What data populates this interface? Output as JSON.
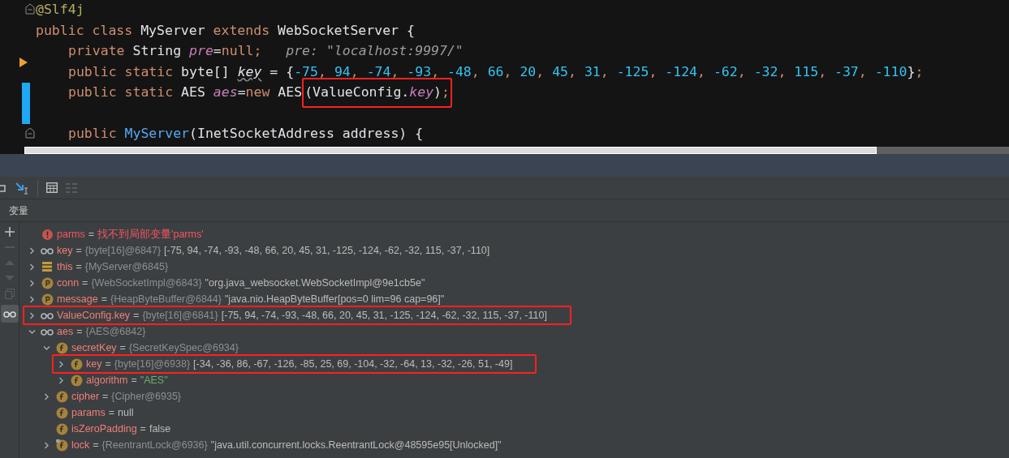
{
  "editor": {
    "lines": [
      {
        "kind": "fold",
        "indented": false,
        "tokens": [
          {
            "kind": "annot",
            "t": "@Slf4j"
          }
        ]
      },
      {
        "kind": "plain",
        "indented": false,
        "tokens": [
          {
            "kind": "kw",
            "t": "public class "
          },
          {
            "kind": "plain",
            "t": "MyServer "
          },
          {
            "kind": "kw",
            "t": "extends "
          },
          {
            "kind": "plain",
            "t": "WebSocketServer {"
          }
        ]
      },
      {
        "kind": "plain",
        "indented": true,
        "tokens": [
          {
            "kind": "kw",
            "t": "private "
          },
          {
            "kind": "plain",
            "t": "String "
          },
          {
            "kind": "field",
            "t": "pre"
          },
          {
            "kind": "plain",
            "t": "="
          },
          {
            "kind": "kw",
            "t": "null;"
          },
          {
            "kind": "hint",
            "t": "   pre: \"localhost:9997/\""
          }
        ]
      },
      {
        "kind": "arrow",
        "indented": true,
        "tokens": [
          {
            "kind": "kw",
            "t": "public static "
          },
          {
            "kind": "plain",
            "t": "byte[] "
          },
          {
            "kind": "squiggle",
            "t": "key"
          },
          {
            "kind": "plain",
            "t": " = {"
          },
          {
            "kind": "num",
            "t": "-75"
          },
          {
            "kind": "punct",
            "t": ", "
          },
          {
            "kind": "num",
            "t": "94"
          },
          {
            "kind": "punct",
            "t": ", "
          },
          {
            "kind": "num",
            "t": "-74"
          },
          {
            "kind": "punct",
            "t": ", "
          },
          {
            "kind": "num",
            "t": "-93"
          },
          {
            "kind": "punct",
            "t": ", "
          },
          {
            "kind": "num",
            "t": "-48"
          },
          {
            "kind": "punct",
            "t": ", "
          },
          {
            "kind": "num",
            "t": "66"
          },
          {
            "kind": "punct",
            "t": ", "
          },
          {
            "kind": "num",
            "t": "20"
          },
          {
            "kind": "punct",
            "t": ", "
          },
          {
            "kind": "num",
            "t": "45"
          },
          {
            "kind": "punct",
            "t": ", "
          },
          {
            "kind": "num",
            "t": "31"
          },
          {
            "kind": "punct",
            "t": ", "
          },
          {
            "kind": "num",
            "t": "-125"
          },
          {
            "kind": "punct",
            "t": ", "
          },
          {
            "kind": "num",
            "t": "-124"
          },
          {
            "kind": "punct",
            "t": ", "
          },
          {
            "kind": "num",
            "t": "-62"
          },
          {
            "kind": "punct",
            "t": ", "
          },
          {
            "kind": "num",
            "t": "-32"
          },
          {
            "kind": "punct",
            "t": ", "
          },
          {
            "kind": "num",
            "t": "115"
          },
          {
            "kind": "punct",
            "t": ", "
          },
          {
            "kind": "num",
            "t": "-37"
          },
          {
            "kind": "punct",
            "t": ", "
          },
          {
            "kind": "num",
            "t": "-110"
          },
          {
            "kind": "plain",
            "t": "}"
          },
          {
            "kind": "punct",
            "t": ";"
          }
        ]
      },
      {
        "kind": "changed",
        "indented": true,
        "tokens": [
          {
            "kind": "kw",
            "t": "public static "
          },
          {
            "kind": "plain",
            "t": "AES "
          },
          {
            "kind": "field",
            "t": "aes"
          },
          {
            "kind": "plain",
            "t": "="
          },
          {
            "kind": "kw",
            "t": "new "
          },
          {
            "kind": "plain",
            "t": "AES"
          }
        ],
        "boxed": [
          {
            "kind": "plain",
            "t": "(ValueConfig."
          },
          {
            "kind": "field",
            "t": "key"
          },
          {
            "kind": "plain",
            "t": ")"
          },
          {
            "kind": "punct",
            "t": ";"
          }
        ]
      },
      {
        "kind": "changed"
      },
      {
        "kind": "fold",
        "indented": true,
        "tokens": [
          {
            "kind": "kw",
            "t": "public "
          },
          {
            "kind": "method",
            "t": "MyServer"
          },
          {
            "kind": "plain",
            "t": "(InetSocketAddress address) {"
          }
        ]
      }
    ]
  },
  "variables_tab": "变量",
  "variables": [
    {
      "kind": "error",
      "name": "parms",
      "operator": "=",
      "value": {
        "kind": "error",
        "t": "找不到局部变量'parms'"
      }
    },
    {
      "kind": "watch",
      "name": "key",
      "operator": "=",
      "type": "{byte[16]@6847}",
      "value": {
        "kind": "plain",
        "t": "[-75, 94, -74, -93, -48, 66, 20, 45, 31, -125, -124, -62, -32, 115, -37, -110]"
      },
      "expanded": false
    },
    {
      "kind": "stack",
      "name": "this",
      "operator": "=",
      "type": "{MyServer@6845}",
      "expanded": false
    },
    {
      "kind": "p",
      "name": "conn",
      "operator": "=",
      "type": "{WebSocketImpl@6843}",
      "value": {
        "kind": "plain",
        "t": "\"org.java_websocket.WebSocketImpl@9e1cb5e\""
      },
      "expanded": false
    },
    {
      "kind": "p",
      "name": "message",
      "operator": "=",
      "type": "{HeapByteBuffer@6844}",
      "value": {
        "kind": "plain",
        "t": "\"java.nio.HeapByteBuffer[pos=0 lim=96 cap=96]\""
      },
      "expanded": false
    },
    {
      "kind": "watch",
      "name": "ValueConfig.key",
      "operator": "=",
      "type": "{byte[16]@6841}",
      "value": {
        "kind": "plain",
        "t": "[-75, 94, -74, -93, -48, 66, 20, 45, 31, -125, -124, -62, -32, 115, -37, -110]"
      },
      "expanded": false,
      "boxed": true
    },
    {
      "kind": "watch",
      "name": "aes",
      "operator": "=",
      "type": "{AES@6842}",
      "expanded": true,
      "children": [
        {
          "kind": "f",
          "name": "secretKey",
          "operator": "=",
          "type": "{SecretKeySpec@6934}",
          "expanded": true,
          "children": [
            {
              "kind": "f",
              "name": "key",
              "operator": "=",
              "type": "{byte[16]@6938}",
              "value": {
                "kind": "plain",
                "t": "[-34, -36, 86, -67, -126, -85, 25, 69, -104, -32, -64, 13, -32, -26, 51, -49]"
              },
              "expanded": false,
              "boxed": true
            },
            {
              "kind": "f",
              "name": "algorithm",
              "operator": "=",
              "value": {
                "kind": "string",
                "t": "\"AES\""
              },
              "expanded": false
            }
          ]
        },
        {
          "kind": "f",
          "name": "cipher",
          "operator": "=",
          "type": "{Cipher@6935}",
          "expanded": false
        },
        {
          "kind": "f",
          "name": "params",
          "operator": "=",
          "value": {
            "kind": "plain",
            "t": "null"
          }
        },
        {
          "kind": "f",
          "name": "isZeroPadding",
          "operator": "=",
          "value": {
            "kind": "plain",
            "t": "false"
          }
        },
        {
          "kind": "f_lock",
          "name": "lock",
          "operator": "=",
          "type": "{ReentrantLock@6936}",
          "value": {
            "kind": "plain",
            "t": "\"java.util.concurrent.locks.ReentrantLock@48595e95[Unlocked]\""
          },
          "expanded": false
        }
      ]
    }
  ]
}
